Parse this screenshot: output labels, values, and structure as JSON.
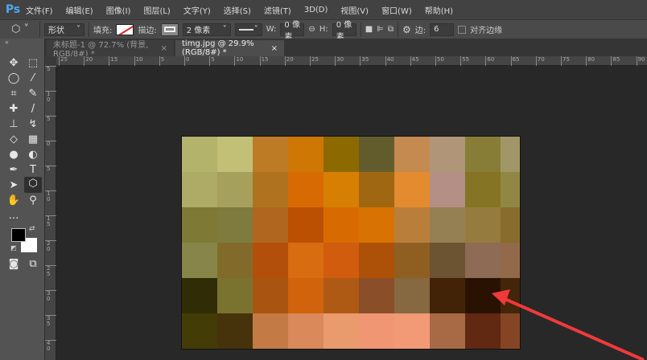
{
  "app": {
    "logo": "Ps"
  },
  "menu": [
    "文件(F)",
    "编辑(E)",
    "图像(I)",
    "图层(L)",
    "文字(Y)",
    "选择(S)",
    "滤镜(T)",
    "3D(D)",
    "视图(V)",
    "窗口(W)",
    "帮助(H)"
  ],
  "options": {
    "shape_mode": "形状",
    "fill_label": "填充:",
    "stroke_label": "描边:",
    "stroke_width": "2 像素",
    "w_label": "W:",
    "w_value": "0 像素",
    "h_label": "H:",
    "h_value": "0 像素",
    "sides_label": "边:",
    "sides_value": "6",
    "align_edges_label": "对齐边缘",
    "align_edges_checked": false,
    "fill_color": "none",
    "stroke_swatch": "#ffffff"
  },
  "tabs": [
    {
      "label": "未标题-1 @ 72.7% (背景, RGB/8#) *",
      "active": false
    },
    {
      "label": "timg.jpg @ 29.9%(RGB/8#) *",
      "active": true
    }
  ],
  "ruler": {
    "h": [
      "25",
      "20",
      "15",
      "10",
      "5",
      "0",
      "5",
      "10",
      "15",
      "20",
      "25",
      "30",
      "35",
      "40",
      "45",
      "50",
      "55",
      "60",
      "65",
      "70",
      "75",
      "80",
      "85",
      "90"
    ],
    "v": [
      "5",
      "1\n0",
      "5",
      "0",
      "5",
      "1\n0",
      "1\n5",
      "2\n0",
      "2\n5",
      "3\n0",
      "3\n5",
      "4\n0"
    ]
  },
  "tools": [
    "move",
    "marquee",
    "lasso",
    "magic-wand",
    "crop",
    "eyedropper",
    "healing",
    "brush",
    "stamp",
    "history-brush",
    "eraser",
    "gradient",
    "blur",
    "dodge",
    "pen",
    "type",
    "path-select",
    "polygon",
    "hand",
    "zoom",
    "more"
  ],
  "colors": {
    "foreground": "#000000",
    "background": "#ffffff",
    "arrow": "#f03a3a"
  },
  "mosaic": [
    [
      "#b3b36b",
      "#c2c077",
      "#bd7b25",
      "#cf7705",
      "#8c6a01",
      "#625c2c",
      "#c48a50",
      "#b19579",
      "#877d37",
      "#a19668"
    ],
    [
      "#adab66",
      "#a5a05c",
      "#af731f",
      "#d76a02",
      "#d67f03",
      "#a06712",
      "#e38b2e",
      "#b38f86",
      "#847423",
      "#908744"
    ],
    [
      "#7e7a35",
      "#7f7b3e",
      "#b0661f",
      "#bb5003",
      "#d76b01",
      "#d87202",
      "#b97f3a",
      "#948053",
      "#967b3e",
      "#876c2d"
    ],
    [
      "#878549",
      "#826b2a",
      "#b24f0a",
      "#d86c11",
      "#d25c0d",
      "#ad5008",
      "#8f5f22",
      "#6c5432",
      "#8e6b54",
      "#92694a"
    ],
    [
      "#302c05",
      "#7a722f",
      "#a95411",
      "#d0630b",
      "#ae5a14",
      "#8a4f28",
      "#866940",
      "#432307",
      "#2a1203",
      "#432509"
    ],
    [
      "#433c07",
      "#46330c",
      "#c37a44",
      "#d9895a",
      "#ea9b6e",
      "#f09673",
      "#f29a75",
      "#a76a45",
      "#612812",
      "#854525"
    ]
  ]
}
